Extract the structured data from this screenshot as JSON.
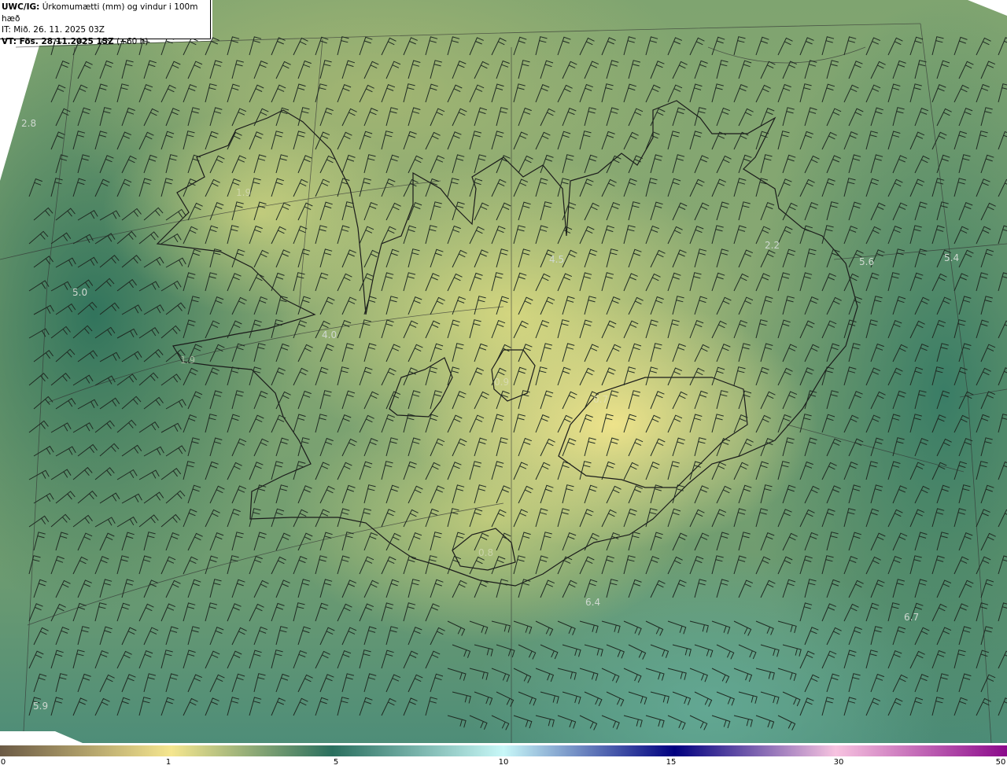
{
  "header": {
    "product": "UWC/IG:",
    "description": "Úrkomumætti (mm) og vindur i 100m hæð",
    "init_time": "IT: Mið. 26. 11. 2025 03Z",
    "valid_time": "VT: Fös. 28.11.2025 15Z",
    "lead": "(+60 h)"
  },
  "value_labels": [
    {
      "text": "2.8",
      "faint": false
    },
    {
      "text": "1.9",
      "faint": true
    },
    {
      "text": "5.0",
      "faint": false
    },
    {
      "text": "4.0",
      "faint": false
    },
    {
      "text": "1.9",
      "faint": true
    },
    {
      "text": "4.5",
      "faint": false
    },
    {
      "text": "2.2",
      "faint": false
    },
    {
      "text": "5.6",
      "faint": false
    },
    {
      "text": "5.4",
      "faint": false
    },
    {
      "text": "0.9",
      "faint": true
    },
    {
      "text": "0.7",
      "faint": true
    },
    {
      "text": "0.8",
      "faint": true
    },
    {
      "text": "6.4",
      "faint": false
    },
    {
      "text": "6.7",
      "faint": false
    },
    {
      "text": "5.9",
      "faint": false
    }
  ],
  "colorbar": {
    "ticks": [
      "0",
      "1",
      "5",
      "10",
      "15",
      "30",
      "50"
    ],
    "colors": [
      "#6b5a45",
      "#f5e68f",
      "#2a6f5e",
      "#c8f8f8",
      "#00007f",
      "#f7c3e0",
      "#8b0a8b"
    ]
  }
}
